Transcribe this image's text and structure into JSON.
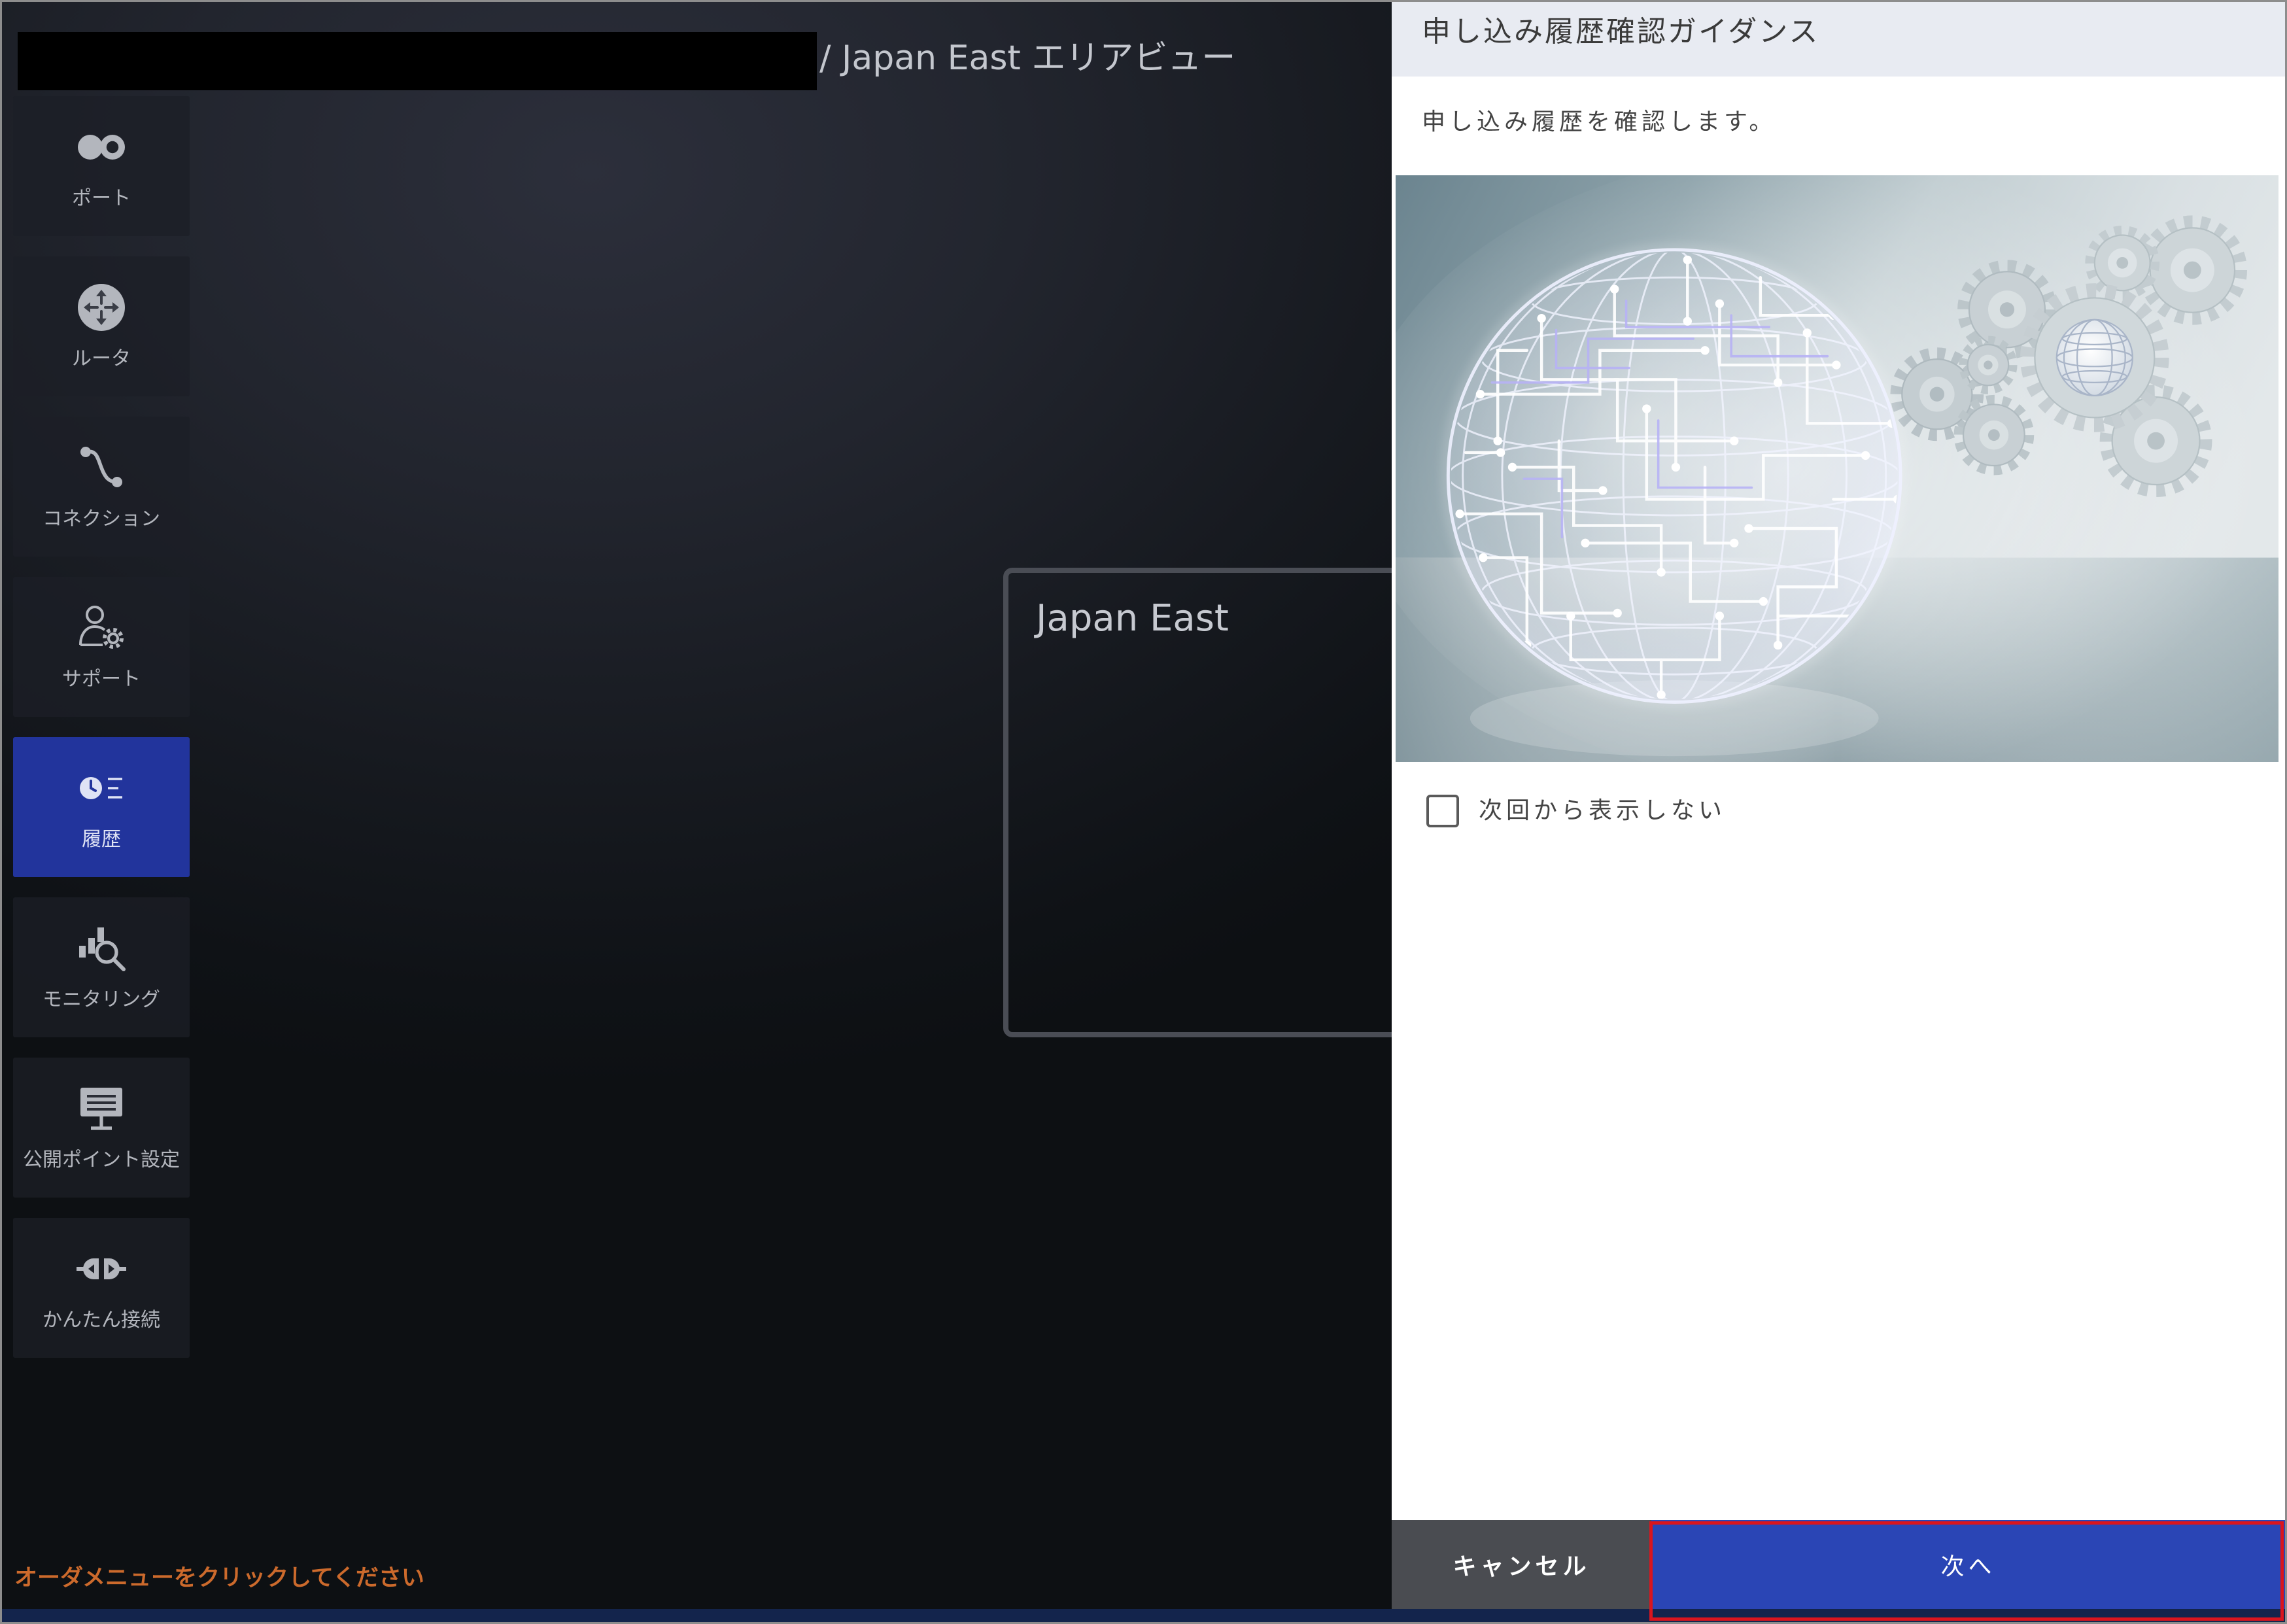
{
  "header": {
    "title": "/ Japan East エリアビュー"
  },
  "sidebar": {
    "items": [
      {
        "label": "ポート",
        "icon": "port-icon",
        "active": false
      },
      {
        "label": "ルータ",
        "icon": "router-icon",
        "active": false
      },
      {
        "label": "コネクション",
        "icon": "connection-icon",
        "active": false
      },
      {
        "label": "サポート",
        "icon": "support-icon",
        "active": false
      },
      {
        "label": "履歴",
        "icon": "history-icon",
        "active": true
      },
      {
        "label": "モニタリング",
        "icon": "monitoring-icon",
        "active": false
      },
      {
        "label": "公開ポイント設定",
        "icon": "public-point-icon",
        "active": false
      },
      {
        "label": "かんたん接続",
        "icon": "easy-connect-icon",
        "active": false
      }
    ]
  },
  "area": {
    "region_label": "Japan East"
  },
  "status": {
    "hint": "オーダメニューをクリックしてください"
  },
  "dialog": {
    "title": "申し込み履歴確認ガイダンス",
    "description": "申し込み履歴を確認します。",
    "checkbox_label": "次回から表示しない",
    "checkbox_checked": false,
    "cancel_label": "キャンセル",
    "next_label": "次へ"
  },
  "colors": {
    "primary_button": "#2a45b5",
    "cancel_button": "#4a4c51",
    "active_nav": "#22349c",
    "hint_text": "#cc6a2c",
    "highlight_border": "#d9151e",
    "dialog_header": "#e8ebf2"
  }
}
